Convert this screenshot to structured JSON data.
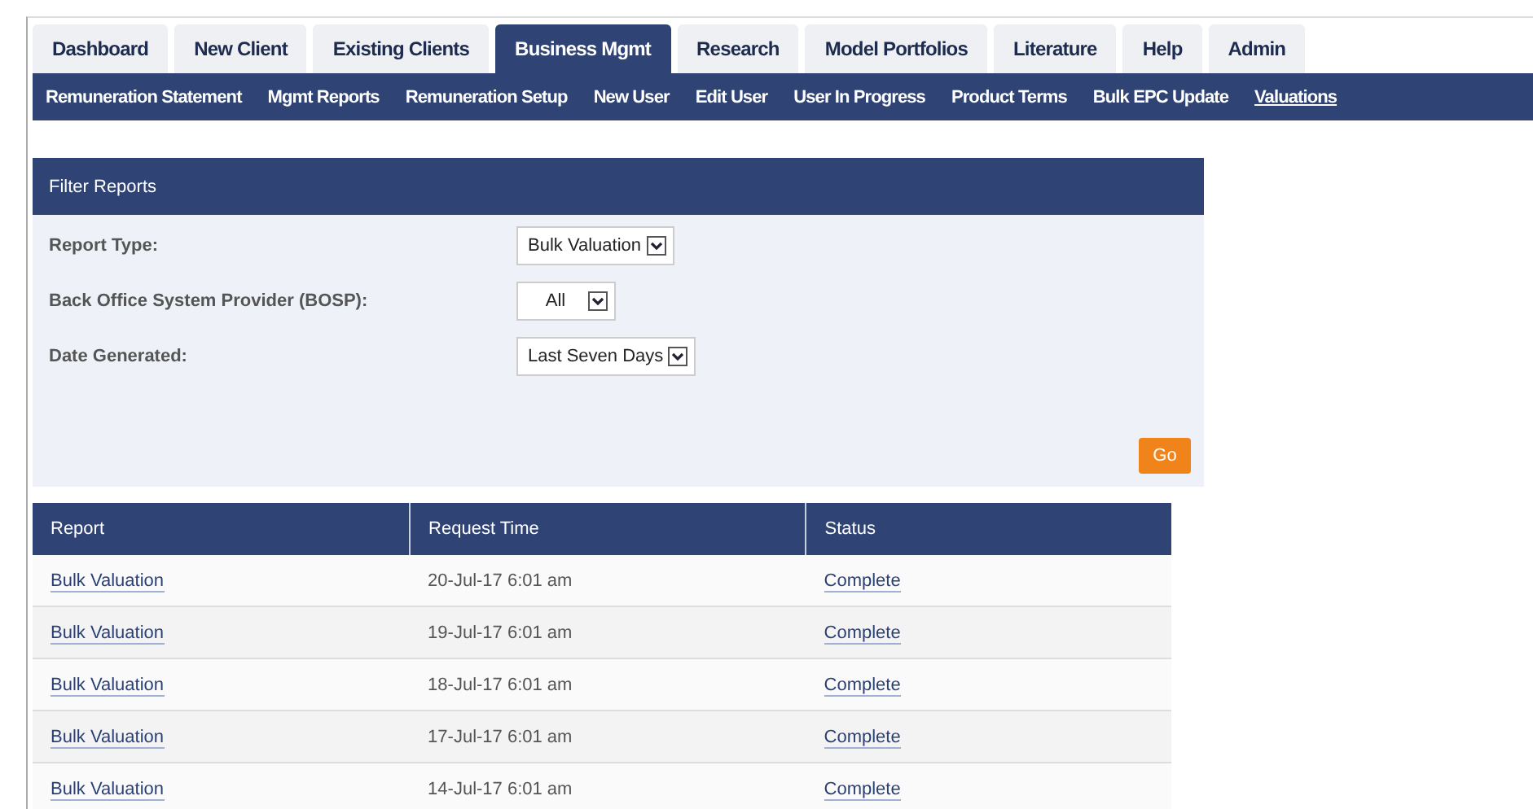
{
  "tabs": [
    {
      "label": "Dashboard",
      "selected": false
    },
    {
      "label": "New Client",
      "selected": false
    },
    {
      "label": "Existing Clients",
      "selected": false
    },
    {
      "label": "Business Mgmt",
      "selected": true
    },
    {
      "label": "Research",
      "selected": false
    },
    {
      "label": "Model Portfolios",
      "selected": false
    },
    {
      "label": "Literature",
      "selected": false
    },
    {
      "label": "Help",
      "selected": false
    },
    {
      "label": "Admin",
      "selected": false
    }
  ],
  "subnav": [
    {
      "label": "Remuneration Statement",
      "selected": false
    },
    {
      "label": "Mgmt Reports",
      "selected": false
    },
    {
      "label": "Remuneration Setup",
      "selected": false
    },
    {
      "label": "New User",
      "selected": false
    },
    {
      "label": "Edit User",
      "selected": false
    },
    {
      "label": "User In Progress",
      "selected": false
    },
    {
      "label": "Product Terms",
      "selected": false
    },
    {
      "label": "Bulk EPC Update",
      "selected": false
    },
    {
      "label": "Valuations",
      "selected": true
    }
  ],
  "filter": {
    "title": "Filter Reports",
    "fields": [
      {
        "label": "Report Type:",
        "value": "Bulk Valuation"
      },
      {
        "label": "Back Office System Provider (BOSP):",
        "value": "All"
      },
      {
        "label": "Date Generated:",
        "value": "Last Seven Days"
      }
    ],
    "button": "Go"
  },
  "table": {
    "columns": [
      "Report",
      "Request Time",
      "Status"
    ],
    "rows": [
      {
        "report": "Bulk Valuation",
        "time": "20-Jul-17 6:01 am",
        "status": "Complete"
      },
      {
        "report": "Bulk Valuation",
        "time": "19-Jul-17 6:01 am",
        "status": "Complete"
      },
      {
        "report": "Bulk Valuation",
        "time": "18-Jul-17 6:01 am",
        "status": "Complete"
      },
      {
        "report": "Bulk Valuation",
        "time": "17-Jul-17 6:01 am",
        "status": "Complete"
      },
      {
        "report": "Bulk Valuation",
        "time": "14-Jul-17 6:01 am",
        "status": "Complete"
      }
    ]
  }
}
